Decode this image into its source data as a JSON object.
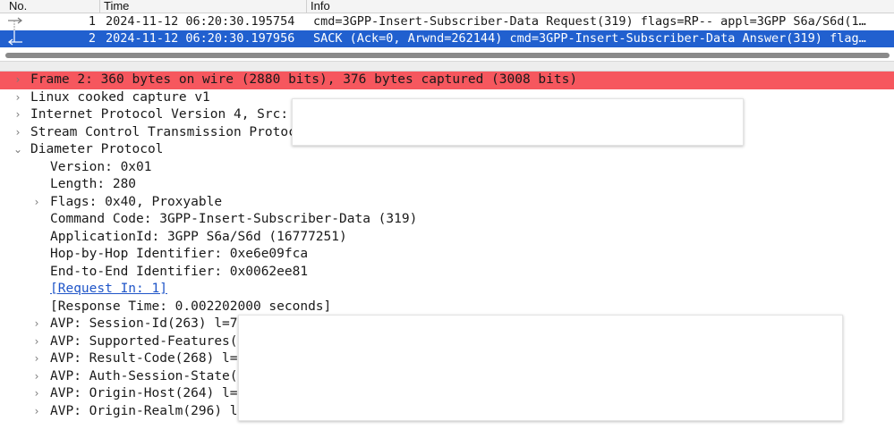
{
  "columns": {
    "no": "No.",
    "time": "Time",
    "info": "Info"
  },
  "packets": [
    {
      "no": "1",
      "time": "2024-11-12 06:20:30.195754",
      "info": "cmd=3GPP-Insert-Subscriber-Data Request(319) flags=RP-- appl=3GPP S6a/S6d(1…"
    },
    {
      "no": "2",
      "time": "2024-11-12 06:20:30.197956",
      "info": "SACK (Ack=0, Arwnd=262144) cmd=3GPP-Insert-Subscriber-Data Answer(319) flag…"
    }
  ],
  "tree": {
    "frame": "Frame 2: 360 bytes on wire (2880 bits), 376 bytes captured (3008 bits)",
    "linux": "Linux cooked capture v1",
    "ip": "Internet Protocol Version 4, Src: i",
    "sctp": "Stream Control Transmission Protoco",
    "diameter": "Diameter Protocol",
    "version": "Version: 0x01",
    "length": "Length: 280",
    "flags": "Flags: 0x40, Proxyable",
    "command_code": "Command Code: 3GPP-Insert-Subscriber-Data (319)",
    "application_id": "ApplicationId: 3GPP S6a/S6d (16777251)",
    "hop_by_hop": "Hop-by-Hop Identifier: 0xe6e09fca",
    "end_to_end": "End-to-End Identifier: 0x0062ee81",
    "request_in": "[Request In: 1]",
    "response_time": "[Response Time: 0.002202000 seconds]",
    "avps": [
      "AVP: Session-Id(263) l=71",
      "AVP: Supported-Features(6",
      "AVP: Result-Code(268) l=1",
      "AVP: Auth-Session-State(2",
      "AVP: Origin-Host(264) l=6",
      "AVP: Origin-Realm(296) l="
    ]
  },
  "colors": {
    "selected": "#2160cf",
    "frame_highlight": "#f6575e",
    "link": "#1f55c8"
  },
  "icons": {
    "collapsed": "chevron-right-icon",
    "expanded": "chevron-down-icon"
  }
}
